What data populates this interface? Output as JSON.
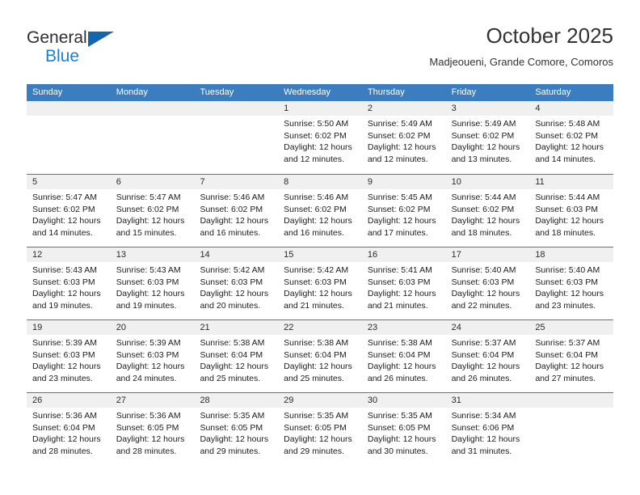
{
  "brand": {
    "name_part1": "General",
    "name_part2": "Blue",
    "logo_icon": "triangle-logo"
  },
  "header": {
    "title": "October 2025",
    "subtitle": "Madjeoueni, Grande Comore, Comoros"
  },
  "colors": {
    "header_blue": "#3b7dbf",
    "brand_blue": "#1b7fd4",
    "day_bar_gray": "#f0f0f0"
  },
  "weekdays": [
    "Sunday",
    "Monday",
    "Tuesday",
    "Wednesday",
    "Thursday",
    "Friday",
    "Saturday"
  ],
  "weeks": [
    [
      {
        "day": "",
        "empty": true
      },
      {
        "day": "",
        "empty": true
      },
      {
        "day": "",
        "empty": true
      },
      {
        "day": "1",
        "sunrise": "Sunrise: 5:50 AM",
        "sunset": "Sunset: 6:02 PM",
        "daylight1": "Daylight: 12 hours",
        "daylight2": "and 12 minutes."
      },
      {
        "day": "2",
        "sunrise": "Sunrise: 5:49 AM",
        "sunset": "Sunset: 6:02 PM",
        "daylight1": "Daylight: 12 hours",
        "daylight2": "and 12 minutes."
      },
      {
        "day": "3",
        "sunrise": "Sunrise: 5:49 AM",
        "sunset": "Sunset: 6:02 PM",
        "daylight1": "Daylight: 12 hours",
        "daylight2": "and 13 minutes."
      },
      {
        "day": "4",
        "sunrise": "Sunrise: 5:48 AM",
        "sunset": "Sunset: 6:02 PM",
        "daylight1": "Daylight: 12 hours",
        "daylight2": "and 14 minutes."
      }
    ],
    [
      {
        "day": "5",
        "sunrise": "Sunrise: 5:47 AM",
        "sunset": "Sunset: 6:02 PM",
        "daylight1": "Daylight: 12 hours",
        "daylight2": "and 14 minutes."
      },
      {
        "day": "6",
        "sunrise": "Sunrise: 5:47 AM",
        "sunset": "Sunset: 6:02 PM",
        "daylight1": "Daylight: 12 hours",
        "daylight2": "and 15 minutes."
      },
      {
        "day": "7",
        "sunrise": "Sunrise: 5:46 AM",
        "sunset": "Sunset: 6:02 PM",
        "daylight1": "Daylight: 12 hours",
        "daylight2": "and 16 minutes."
      },
      {
        "day": "8",
        "sunrise": "Sunrise: 5:46 AM",
        "sunset": "Sunset: 6:02 PM",
        "daylight1": "Daylight: 12 hours",
        "daylight2": "and 16 minutes."
      },
      {
        "day": "9",
        "sunrise": "Sunrise: 5:45 AM",
        "sunset": "Sunset: 6:02 PM",
        "daylight1": "Daylight: 12 hours",
        "daylight2": "and 17 minutes."
      },
      {
        "day": "10",
        "sunrise": "Sunrise: 5:44 AM",
        "sunset": "Sunset: 6:02 PM",
        "daylight1": "Daylight: 12 hours",
        "daylight2": "and 18 minutes."
      },
      {
        "day": "11",
        "sunrise": "Sunrise: 5:44 AM",
        "sunset": "Sunset: 6:03 PM",
        "daylight1": "Daylight: 12 hours",
        "daylight2": "and 18 minutes."
      }
    ],
    [
      {
        "day": "12",
        "sunrise": "Sunrise: 5:43 AM",
        "sunset": "Sunset: 6:03 PM",
        "daylight1": "Daylight: 12 hours",
        "daylight2": "and 19 minutes."
      },
      {
        "day": "13",
        "sunrise": "Sunrise: 5:43 AM",
        "sunset": "Sunset: 6:03 PM",
        "daylight1": "Daylight: 12 hours",
        "daylight2": "and 19 minutes."
      },
      {
        "day": "14",
        "sunrise": "Sunrise: 5:42 AM",
        "sunset": "Sunset: 6:03 PM",
        "daylight1": "Daylight: 12 hours",
        "daylight2": "and 20 minutes."
      },
      {
        "day": "15",
        "sunrise": "Sunrise: 5:42 AM",
        "sunset": "Sunset: 6:03 PM",
        "daylight1": "Daylight: 12 hours",
        "daylight2": "and 21 minutes."
      },
      {
        "day": "16",
        "sunrise": "Sunrise: 5:41 AM",
        "sunset": "Sunset: 6:03 PM",
        "daylight1": "Daylight: 12 hours",
        "daylight2": "and 21 minutes."
      },
      {
        "day": "17",
        "sunrise": "Sunrise: 5:40 AM",
        "sunset": "Sunset: 6:03 PM",
        "daylight1": "Daylight: 12 hours",
        "daylight2": "and 22 minutes."
      },
      {
        "day": "18",
        "sunrise": "Sunrise: 5:40 AM",
        "sunset": "Sunset: 6:03 PM",
        "daylight1": "Daylight: 12 hours",
        "daylight2": "and 23 minutes."
      }
    ],
    [
      {
        "day": "19",
        "sunrise": "Sunrise: 5:39 AM",
        "sunset": "Sunset: 6:03 PM",
        "daylight1": "Daylight: 12 hours",
        "daylight2": "and 23 minutes."
      },
      {
        "day": "20",
        "sunrise": "Sunrise: 5:39 AM",
        "sunset": "Sunset: 6:03 PM",
        "daylight1": "Daylight: 12 hours",
        "daylight2": "and 24 minutes."
      },
      {
        "day": "21",
        "sunrise": "Sunrise: 5:38 AM",
        "sunset": "Sunset: 6:04 PM",
        "daylight1": "Daylight: 12 hours",
        "daylight2": "and 25 minutes."
      },
      {
        "day": "22",
        "sunrise": "Sunrise: 5:38 AM",
        "sunset": "Sunset: 6:04 PM",
        "daylight1": "Daylight: 12 hours",
        "daylight2": "and 25 minutes."
      },
      {
        "day": "23",
        "sunrise": "Sunrise: 5:38 AM",
        "sunset": "Sunset: 6:04 PM",
        "daylight1": "Daylight: 12 hours",
        "daylight2": "and 26 minutes."
      },
      {
        "day": "24",
        "sunrise": "Sunrise: 5:37 AM",
        "sunset": "Sunset: 6:04 PM",
        "daylight1": "Daylight: 12 hours",
        "daylight2": "and 26 minutes."
      },
      {
        "day": "25",
        "sunrise": "Sunrise: 5:37 AM",
        "sunset": "Sunset: 6:04 PM",
        "daylight1": "Daylight: 12 hours",
        "daylight2": "and 27 minutes."
      }
    ],
    [
      {
        "day": "26",
        "sunrise": "Sunrise: 5:36 AM",
        "sunset": "Sunset: 6:04 PM",
        "daylight1": "Daylight: 12 hours",
        "daylight2": "and 28 minutes."
      },
      {
        "day": "27",
        "sunrise": "Sunrise: 5:36 AM",
        "sunset": "Sunset: 6:05 PM",
        "daylight1": "Daylight: 12 hours",
        "daylight2": "and 28 minutes."
      },
      {
        "day": "28",
        "sunrise": "Sunrise: 5:35 AM",
        "sunset": "Sunset: 6:05 PM",
        "daylight1": "Daylight: 12 hours",
        "daylight2": "and 29 minutes."
      },
      {
        "day": "29",
        "sunrise": "Sunrise: 5:35 AM",
        "sunset": "Sunset: 6:05 PM",
        "daylight1": "Daylight: 12 hours",
        "daylight2": "and 29 minutes."
      },
      {
        "day": "30",
        "sunrise": "Sunrise: 5:35 AM",
        "sunset": "Sunset: 6:05 PM",
        "daylight1": "Daylight: 12 hours",
        "daylight2": "and 30 minutes."
      },
      {
        "day": "31",
        "sunrise": "Sunrise: 5:34 AM",
        "sunset": "Sunset: 6:06 PM",
        "daylight1": "Daylight: 12 hours",
        "daylight2": "and 31 minutes."
      },
      {
        "day": "",
        "empty": true
      }
    ]
  ]
}
